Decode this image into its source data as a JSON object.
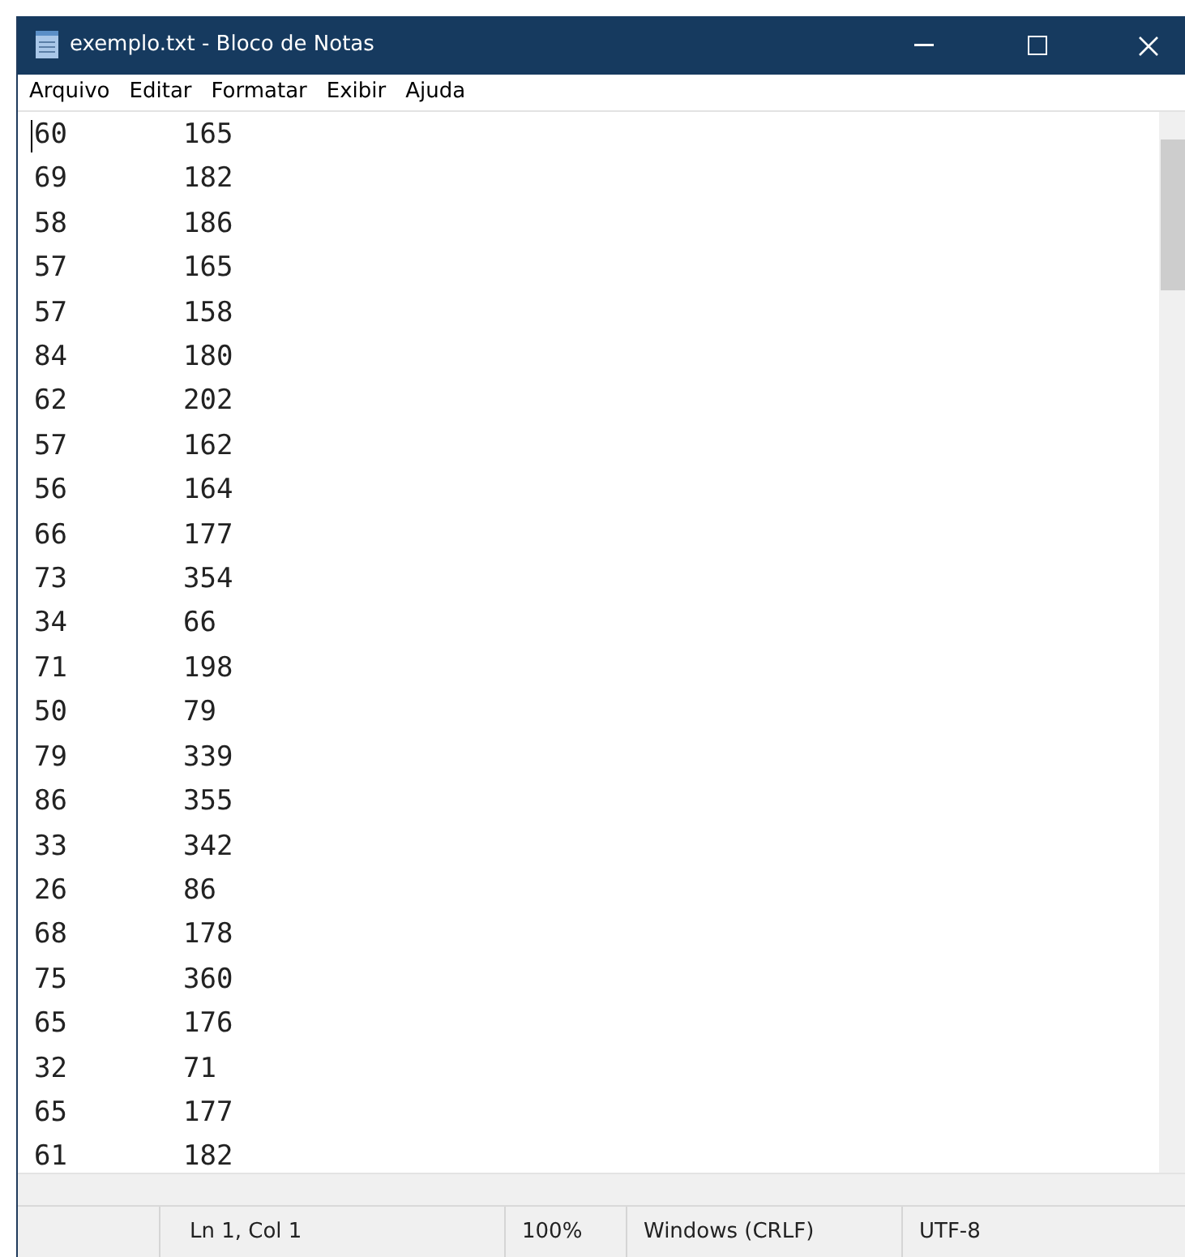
{
  "window": {
    "title": "exemplo.txt - Bloco de Notas"
  },
  "menu": [
    "Arquivo",
    "Editar",
    "Formatar",
    "Exibir",
    "Ajuda"
  ],
  "lines": [
    {
      "col_1": "60",
      "col_2": "165"
    },
    {
      "col_1": "69",
      "col_2": "182"
    },
    {
      "col_1": "58",
      "col_2": "186"
    },
    {
      "col_1": "57",
      "col_2": "165"
    },
    {
      "col_1": "57",
      "col_2": "158"
    },
    {
      "col_1": "84",
      "col_2": "180"
    },
    {
      "col_1": "62",
      "col_2": "202"
    },
    {
      "col_1": "57",
      "col_2": "162"
    },
    {
      "col_1": "56",
      "col_2": "164"
    },
    {
      "col_1": "66",
      "col_2": "177"
    },
    {
      "col_1": "73",
      "col_2": "354"
    },
    {
      "col_1": "34",
      "col_2": "66"
    },
    {
      "col_1": "71",
      "col_2": "198"
    },
    {
      "col_1": "50",
      "col_2": "79"
    },
    {
      "col_1": "79",
      "col_2": "339"
    },
    {
      "col_1": "86",
      "col_2": "355"
    },
    {
      "col_1": "33",
      "col_2": "342"
    },
    {
      "col_1": "26",
      "col_2": "86"
    },
    {
      "col_1": "68",
      "col_2": "178"
    },
    {
      "col_1": "75",
      "col_2": "360"
    },
    {
      "col_1": "65",
      "col_2": "176"
    },
    {
      "col_1": "32",
      "col_2": "71"
    },
    {
      "col_1": "65",
      "col_2": "177"
    },
    {
      "col_1": "61",
      "col_2": "182"
    }
  ],
  "status_bar": {
    "position": "Ln 1, Col 1",
    "zoom": "100%",
    "line_ending": "Windows (CRLF)",
    "encoding": "UTF-8"
  }
}
